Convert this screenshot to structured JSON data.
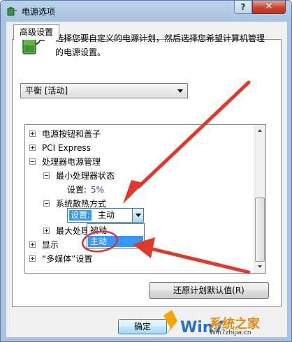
{
  "window": {
    "title": "电源选项",
    "help_label": "?",
    "close_label": "✕"
  },
  "tab": {
    "label": "高级设置"
  },
  "description": "选择您要自定义的电源计划，然后选择您希望计算机管理的电源设置。",
  "plan_select": {
    "value": "平衡 [活动]"
  },
  "tree": {
    "items": [
      {
        "label": "电源按钮和盖子",
        "expander": "plus"
      },
      {
        "label": "PCI Express",
        "expander": "plus"
      },
      {
        "label": "处理器电源管理",
        "expander": "minus"
      },
      {
        "label": "最小处理器状态",
        "expander": "minus"
      },
      {
        "setting_key": "设置:",
        "setting_value": "5%"
      },
      {
        "label": "系统散热方式",
        "expander": "minus"
      },
      {
        "label": "最大处理",
        "expander": "plus"
      },
      {
        "label": "显示",
        "expander": "plus"
      },
      {
        "label": "“多媒体”设置",
        "expander": "plus"
      }
    ],
    "cooling_combo": {
      "key": "设置:",
      "value": "主动"
    },
    "dropdown_options": [
      "被动",
      "主动"
    ]
  },
  "buttons": {
    "restore": "还原计划默认值(R)",
    "ok": "确定"
  },
  "watermark": {
    "text": "系统之家",
    "url": "Win7zhijia.cn",
    "letters": "Win7"
  },
  "colors": {
    "arrow_red": "#e0392b",
    "selection_blue": "#3399ff"
  },
  "icons": [
    "power-options-icon",
    "battery-plug-icon"
  ]
}
